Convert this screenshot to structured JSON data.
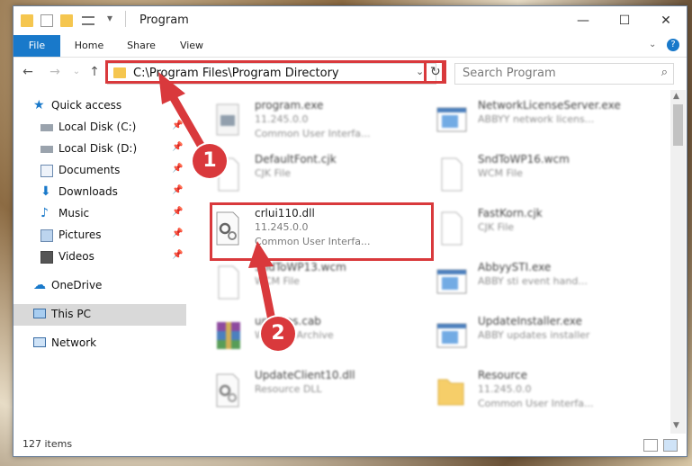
{
  "window": {
    "title": "Program",
    "controls": {
      "minimize": "—",
      "maximize": "☐",
      "close": "✕"
    }
  },
  "ribbon": {
    "tabs": [
      "File",
      "Home",
      "Share",
      "View"
    ],
    "help": "?"
  },
  "address": {
    "path": "C:\\Program Files\\Program Directory",
    "search_placeholder": "Search Program"
  },
  "navigation": {
    "items": [
      {
        "label": "Quick access",
        "icon": "star-icon",
        "pinned": false
      },
      {
        "label": "Local Disk (C:)",
        "icon": "drive-icon",
        "pinned": true
      },
      {
        "label": "Local Disk (D:)",
        "icon": "drive-icon",
        "pinned": true
      },
      {
        "label": "Documents",
        "icon": "documents-icon",
        "pinned": true
      },
      {
        "label": "Downloads",
        "icon": "download-icon",
        "pinned": true
      },
      {
        "label": "Music",
        "icon": "music-icon",
        "pinned": true
      },
      {
        "label": "Pictures",
        "icon": "pictures-icon",
        "pinned": true
      },
      {
        "label": "Videos",
        "icon": "videos-icon",
        "pinned": true
      },
      {
        "label": "OneDrive",
        "icon": "cloud-icon",
        "pinned": false
      },
      {
        "label": "This PC",
        "icon": "computer-icon",
        "pinned": false,
        "selected": true
      },
      {
        "label": "Network",
        "icon": "network-icon",
        "pinned": false
      }
    ]
  },
  "files": [
    {
      "name": "program.exe",
      "line2": "11.245.0.0",
      "line3": "Common User Interfa...",
      "icon": "exe-icon"
    },
    {
      "name": "DefaultFont.cjk",
      "line2": "CJK File",
      "line3": "",
      "icon": "blank-file-icon"
    },
    {
      "name": "crlui110.dll",
      "line2": "11.245.0.0",
      "line3": "Common User Interfa...",
      "icon": "dll-gear-icon",
      "highlighted": true
    },
    {
      "name": "SndToWP13.wcm",
      "line2": "WCM File",
      "line3": "",
      "icon": "blank-file-icon"
    },
    {
      "name": "updates.cab",
      "line2": "WinRAR Archive",
      "line3": "",
      "icon": "winrar-icon"
    },
    {
      "name": "UpdateClient10.dll",
      "line2": "Resource DLL",
      "line3": "",
      "icon": "dll-gear-icon"
    },
    {
      "name": "NetworkLicenseServer.exe",
      "line2": "ABBYY network licens...",
      "line3": "",
      "icon": "app-window-icon"
    },
    {
      "name": "SndToWP16.wcm",
      "line2": "WCM File",
      "line3": "",
      "icon": "blank-file-icon"
    },
    {
      "name": "FastKorn.cjk",
      "line2": "CJK File",
      "line3": "",
      "icon": "blank-file-icon"
    },
    {
      "name": "AbbyySTI.exe",
      "line2": "ABBY sti event hand...",
      "line3": "",
      "icon": "app-window-icon"
    },
    {
      "name": "UpdateInstaller.exe",
      "line2": "ABBY updates installer",
      "line3": "",
      "icon": "app-window-icon"
    },
    {
      "name": "Resource",
      "line2": "11.245.0.0",
      "line3": "Common User Interfa...",
      "icon": "folder-icon"
    }
  ],
  "status": {
    "count": "127 items"
  },
  "annotations": {
    "step1": "1",
    "step2": "2"
  },
  "colors": {
    "accent": "#1979ca",
    "highlight": "#d9393c",
    "folder": "#f5c64f"
  }
}
